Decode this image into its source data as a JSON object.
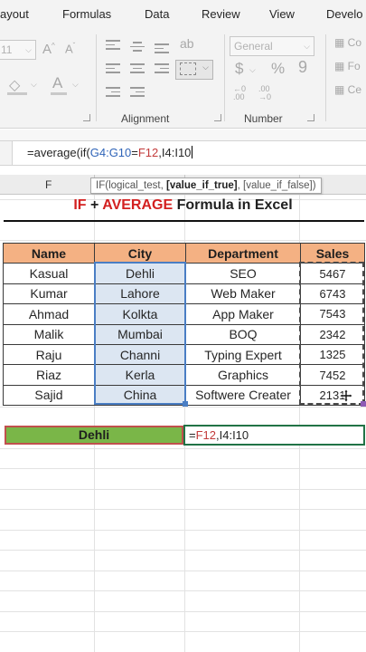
{
  "ribbon": {
    "tabs": [
      "ayout",
      "Formulas",
      "Data",
      "Review",
      "View",
      "Develo"
    ],
    "font_size_value": "11",
    "number_format_value": "General",
    "currency_symbol": "$",
    "percent_symbol": "%",
    "comma_symbol": "9",
    "groups": {
      "alignment": "Alignment",
      "number": "Number"
    }
  },
  "formula_bar": {
    "prefix": "=average(if(",
    "range1": "G4:G10",
    "eq": "=",
    "criteria_ref": "F12",
    "comma": ",",
    "range2": "I4:I10"
  },
  "column_header": {
    "label": "F"
  },
  "tooltip": {
    "fn": "IF(",
    "arg1": "logical_test",
    "sep1": ", ",
    "arg2": "[value_if_true]",
    "sep2": ", ",
    "arg3": "[value_if_false]",
    "close": ")"
  },
  "title": {
    "part1": "IF",
    "part2": " + ",
    "part3": "AVERAGE",
    "part4": " Formula in Excel"
  },
  "table": {
    "headers": [
      "Name",
      "City",
      "Department",
      "Sales"
    ],
    "rows": [
      {
        "name": "Kasual",
        "city": "Dehli",
        "dept": "SEO",
        "sales": "5467"
      },
      {
        "name": "Kumar",
        "city": "Lahore",
        "dept": "Web Maker",
        "sales": "6743"
      },
      {
        "name": "Ahmad",
        "city": "Kolkta",
        "dept": "App Maker",
        "sales": "7543"
      },
      {
        "name": "Malik",
        "city": "Mumbai",
        "dept": "BOQ",
        "sales": "2342"
      },
      {
        "name": "Raju",
        "city": "Channi",
        "dept": "Typing Expert",
        "sales": "1325"
      },
      {
        "name": "Riaz",
        "city": "Kerla",
        "dept": "Graphics",
        "sales": "7452"
      },
      {
        "name": "Sajid",
        "city": "China",
        "dept": "Softwere Creater",
        "sales": "2131"
      }
    ]
  },
  "criteria_cell": {
    "value": "Dehli"
  },
  "active_cell": {
    "prefix": "=",
    "criteria_ref": "F12",
    "rest": ",I4:I10"
  },
  "colors": {
    "header_fill": "#f4b183",
    "criteria_fill": "#7ab648",
    "city_fill": "#dce6f2",
    "title_red": "#d32020"
  }
}
